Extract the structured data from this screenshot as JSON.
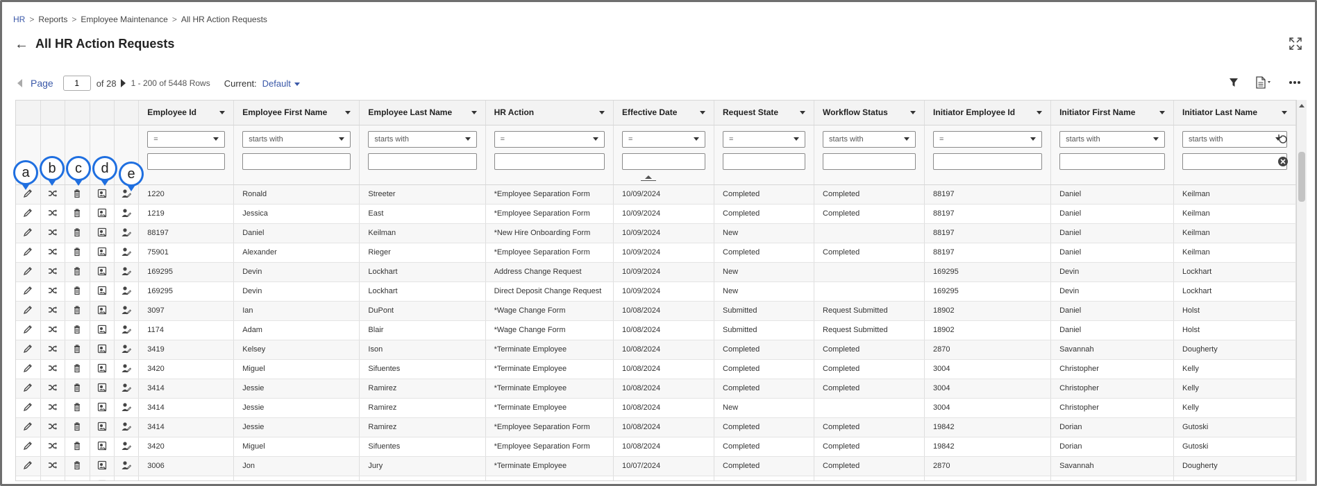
{
  "breadcrumb": [
    {
      "label": "HR",
      "link": true
    },
    {
      "label": "Reports",
      "link": false
    },
    {
      "label": "Employee Maintenance",
      "link": false
    },
    {
      "label": "All HR Action Requests",
      "link": false
    }
  ],
  "breadcrumb_sep": ">",
  "page_title": "All HR Action Requests",
  "pager": {
    "page_label": "Page",
    "page_value": "1",
    "of_label": "of 28",
    "rows_label": "1 - 200 of 5448 Rows",
    "current_label": "Current:",
    "current_value": "Default"
  },
  "annotations": [
    "a",
    "b",
    "c",
    "d",
    "e"
  ],
  "columns": [
    {
      "label": "Employee Id",
      "filter": "="
    },
    {
      "label": "Employee First Name",
      "filter": "starts with"
    },
    {
      "label": "Employee Last Name",
      "filter": "starts with"
    },
    {
      "label": "HR Action",
      "filter": "="
    },
    {
      "label": "Effective Date",
      "filter": "="
    },
    {
      "label": "Request State",
      "filter": "="
    },
    {
      "label": "Workflow Status",
      "filter": "starts with"
    },
    {
      "label": "Initiator Employee Id",
      "filter": "="
    },
    {
      "label": "Initiator First Name",
      "filter": "starts with"
    },
    {
      "label": "Initiator Last Name",
      "filter": "starts with"
    }
  ],
  "action_icons": [
    "edit-icon",
    "shuffle-icon",
    "trash-icon",
    "record-icon",
    "user-edit-icon"
  ],
  "rows": [
    [
      "1220",
      "Ronald",
      "Streeter",
      "*Employee Separation Form",
      "10/09/2024",
      "Completed",
      "Completed",
      "88197",
      "Daniel",
      "Keilman"
    ],
    [
      "1219",
      "Jessica",
      "East",
      "*Employee Separation Form",
      "10/09/2024",
      "Completed",
      "Completed",
      "88197",
      "Daniel",
      "Keilman"
    ],
    [
      "88197",
      "Daniel",
      "Keilman",
      "*New Hire Onboarding Form",
      "10/09/2024",
      "New",
      "",
      "88197",
      "Daniel",
      "Keilman"
    ],
    [
      "75901",
      "Alexander",
      "Rieger",
      "*Employee Separation Form",
      "10/09/2024",
      "Completed",
      "Completed",
      "88197",
      "Daniel",
      "Keilman"
    ],
    [
      "169295",
      "Devin",
      "Lockhart",
      "Address Change Request",
      "10/09/2024",
      "New",
      "",
      "169295",
      "Devin",
      "Lockhart"
    ],
    [
      "169295",
      "Devin",
      "Lockhart",
      "Direct Deposit Change Request",
      "10/09/2024",
      "New",
      "",
      "169295",
      "Devin",
      "Lockhart"
    ],
    [
      "3097",
      "Ian",
      "DuPont",
      "*Wage Change Form",
      "10/08/2024",
      "Submitted",
      "Request Submitted",
      "18902",
      "Daniel",
      "Holst"
    ],
    [
      "1174",
      "Adam",
      "Blair",
      "*Wage Change Form",
      "10/08/2024",
      "Submitted",
      "Request Submitted",
      "18902",
      "Daniel",
      "Holst"
    ],
    [
      "3419",
      "Kelsey",
      "Ison",
      "*Terminate Employee",
      "10/08/2024",
      "Completed",
      "Completed",
      "2870",
      "Savannah",
      "Dougherty"
    ],
    [
      "3420",
      "Miguel",
      "Sifuentes",
      "*Terminate Employee",
      "10/08/2024",
      "Completed",
      "Completed",
      "3004",
      "Christopher",
      "Kelly"
    ],
    [
      "3414",
      "Jessie",
      "Ramirez",
      "*Terminate Employee",
      "10/08/2024",
      "Completed",
      "Completed",
      "3004",
      "Christopher",
      "Kelly"
    ],
    [
      "3414",
      "Jessie",
      "Ramirez",
      "*Terminate Employee",
      "10/08/2024",
      "New",
      "",
      "3004",
      "Christopher",
      "Kelly"
    ],
    [
      "3414",
      "Jessie",
      "Ramirez",
      "*Employee Separation Form",
      "10/08/2024",
      "Completed",
      "Completed",
      "19842",
      "Dorian",
      "Gutoski"
    ],
    [
      "3420",
      "Miguel",
      "Sifuentes",
      "*Employee Separation Form",
      "10/08/2024",
      "Completed",
      "Completed",
      "19842",
      "Dorian",
      "Gutoski"
    ],
    [
      "3006",
      "Jon",
      "Jury",
      "*Terminate Employee",
      "10/07/2024",
      "Completed",
      "Completed",
      "2870",
      "Savannah",
      "Dougherty"
    ],
    [
      "",
      "",
      "",
      "",
      "",
      "",
      "",
      "",
      "",
      ""
    ]
  ],
  "colors": {
    "accent": "#3a58a8",
    "annotation": "#1f6fe0"
  }
}
